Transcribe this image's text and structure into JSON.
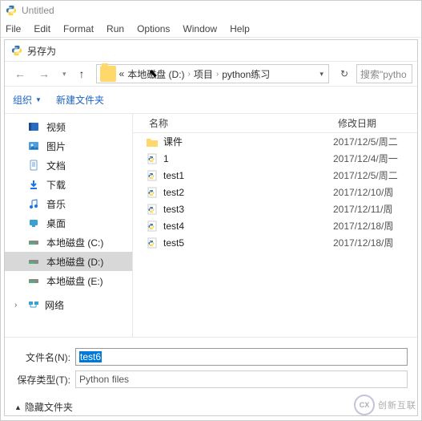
{
  "app": {
    "title": "Untitled"
  },
  "menubar": [
    "File",
    "Edit",
    "Format",
    "Run",
    "Options",
    "Window",
    "Help"
  ],
  "dialog": {
    "title": "另存为",
    "breadcrumb": [
      "本地磁盘 (D:)",
      "项目",
      "python练习"
    ],
    "breadcrumb_prefix": "«",
    "search_placeholder": "搜索\"pytho",
    "toolbar": {
      "organize": "组织",
      "new_folder": "新建文件夹"
    },
    "columns": {
      "name": "名称",
      "date": "修改日期"
    },
    "sidebar": {
      "quick": [
        {
          "icon": "video",
          "label": "视频"
        },
        {
          "icon": "pictures",
          "label": "图片"
        },
        {
          "icon": "documents",
          "label": "文档"
        },
        {
          "icon": "downloads",
          "label": "下载"
        },
        {
          "icon": "music",
          "label": "音乐"
        },
        {
          "icon": "desktop",
          "label": "桌面"
        },
        {
          "icon": "drive",
          "label": "本地磁盘 (C:)"
        },
        {
          "icon": "drive",
          "label": "本地磁盘 (D:)",
          "selected": true
        },
        {
          "icon": "drive",
          "label": "本地磁盘 (E:)"
        }
      ],
      "network_label": "网络"
    },
    "files": [
      {
        "type": "folder",
        "name": "课件",
        "date": "2017/12/5/周二"
      },
      {
        "type": "py",
        "name": "1",
        "date": "2017/12/4/周一"
      },
      {
        "type": "py",
        "name": "test1",
        "date": "2017/12/5/周二"
      },
      {
        "type": "py",
        "name": "test2",
        "date": "2017/12/10/周"
      },
      {
        "type": "py",
        "name": "test3",
        "date": "2017/12/11/周"
      },
      {
        "type": "py",
        "name": "test4",
        "date": "2017/12/18/周"
      },
      {
        "type": "py",
        "name": "test5",
        "date": "2017/12/18/周"
      }
    ],
    "form": {
      "filename_label": "文件名(N):",
      "filename_value": "test6",
      "type_label": "保存类型(T):",
      "type_value": "Python files"
    },
    "footer": {
      "hide_folders": "隐藏文件夹"
    }
  },
  "watermark": {
    "badge": "CX",
    "text": "创新互联"
  }
}
